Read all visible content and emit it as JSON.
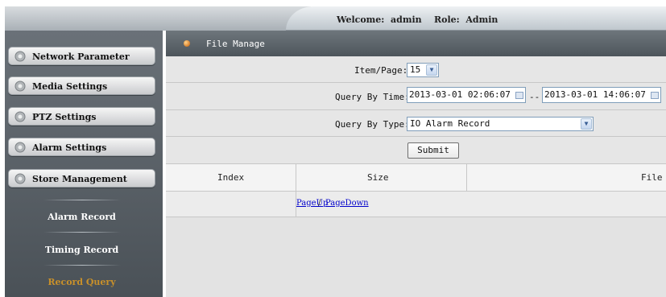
{
  "header": {
    "welcome_text": "Welcome:  admin    Role:  Admin"
  },
  "sidebar": {
    "buttons": [
      {
        "label": "Network Parameter"
      },
      {
        "label": "Media Settings"
      },
      {
        "label": "PTZ Settings"
      },
      {
        "label": "Alarm Settings"
      },
      {
        "label": "Store Management"
      }
    ],
    "sub_items": [
      {
        "label": "Alarm Record",
        "color": "#ffffff"
      },
      {
        "label": "Timing Record",
        "color": "#ffffff"
      },
      {
        "label": "Record Query",
        "color": "#c8902a"
      }
    ]
  },
  "panel": {
    "title": "File Manage",
    "item_page_label": "Item/Page:",
    "item_page_value": "15",
    "query_time_label": "Query By Time:",
    "start_time": "2013-03-01 02:06:07",
    "separator": "--",
    "end_time": "2013-03-01 14:06:07",
    "query_type_label": "Query By Type:",
    "query_type_value": "IO Alarm Record",
    "submit_label": "Submit"
  },
  "table": {
    "columns": [
      "Index",
      "Size",
      "File"
    ]
  },
  "pager": {
    "page_up": "PageUp",
    "page_sep": "/",
    "page_down": "PageDown"
  }
}
